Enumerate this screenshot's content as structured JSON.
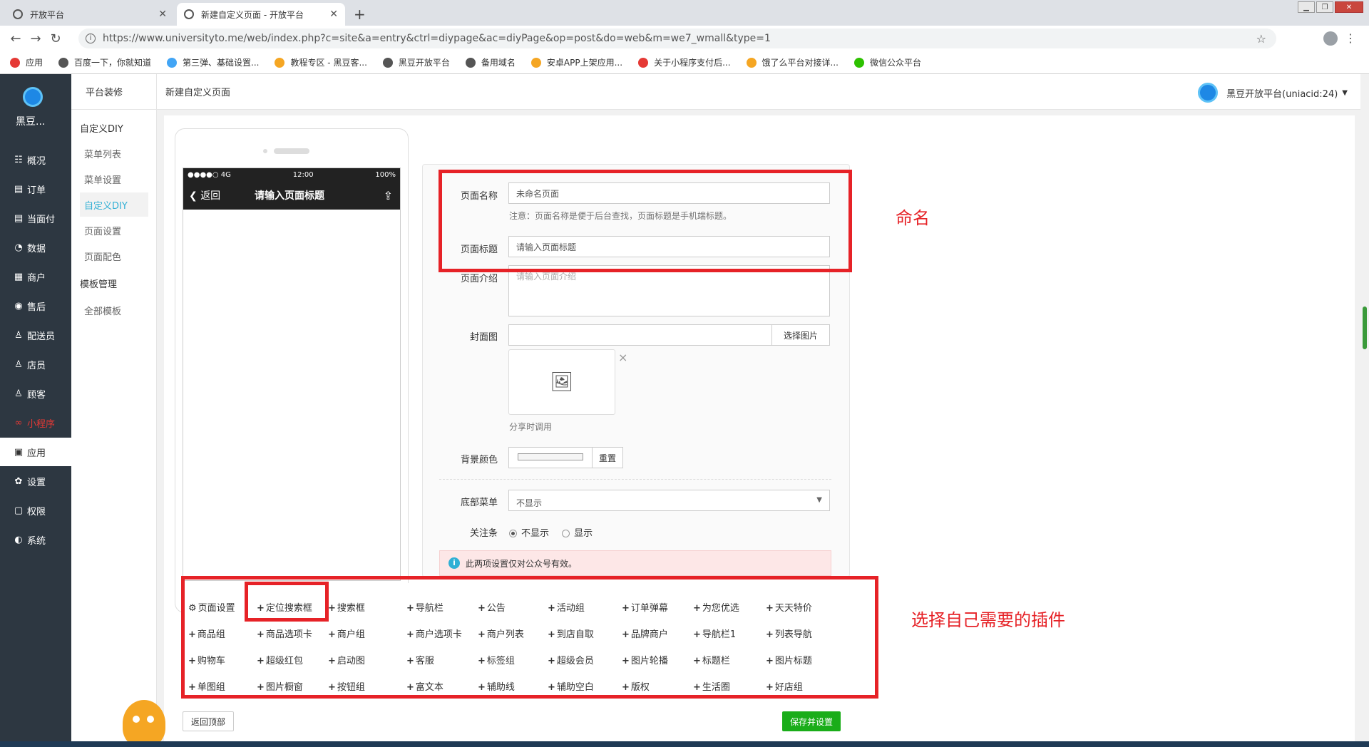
{
  "browser": {
    "tabs": [
      {
        "title": "开放平台"
      },
      {
        "title": "新建自定义页面 - 开放平台"
      }
    ],
    "new_tab": "+",
    "url": "https://www.universityto.me/web/index.php?c=site&a=entry&ctrl=diypage&ac=diyPage&op=post&do=web&m=we7_wmall&type=1",
    "bookmarks": [
      {
        "label": "应用",
        "color": "#e53935"
      },
      {
        "label": "百度一下，你就知道",
        "color": "#555555"
      },
      {
        "label": "第三弹、基础设置...",
        "color": "#42a5f5"
      },
      {
        "label": "教程专区 - 黑豆客...",
        "color": "#f5a623"
      },
      {
        "label": "黑豆开放平台",
        "color": "#555555"
      },
      {
        "label": "备用域名",
        "color": "#555555"
      },
      {
        "label": "安卓APP上架应用...",
        "color": "#f5a623"
      },
      {
        "label": "关于小程序支付后...",
        "color": "#e53935"
      },
      {
        "label": "饿了么平台对接详...",
        "color": "#f5a623"
      },
      {
        "label": "微信公众平台",
        "color": "#2dc100"
      }
    ]
  },
  "sidebar": {
    "brand": "黑豆...",
    "items": [
      {
        "label": "概况",
        "icon": "☷"
      },
      {
        "label": "订单",
        "icon": "▤"
      },
      {
        "label": "当面付",
        "icon": "▤"
      },
      {
        "label": "数据",
        "icon": "◔"
      },
      {
        "label": "商户",
        "icon": "▦"
      },
      {
        "label": "售后",
        "icon": "◉"
      },
      {
        "label": "配送员",
        "icon": "♙"
      },
      {
        "label": "店员",
        "icon": "♙"
      },
      {
        "label": "顾客",
        "icon": "♙"
      },
      {
        "label": "小程序",
        "icon": "∞"
      },
      {
        "label": "应用",
        "icon": "▣"
      },
      {
        "label": "设置",
        "icon": "✿"
      },
      {
        "label": "权限",
        "icon": "▢"
      },
      {
        "label": "系统",
        "icon": "◐"
      }
    ]
  },
  "subnav": {
    "header": "平台装修",
    "group1": "自定义DIY",
    "group1_items": [
      "菜单列表",
      "菜单设置",
      "自定义DIY",
      "页面设置",
      "页面配色"
    ],
    "group2": "模板管理",
    "group2_items": [
      "全部模板"
    ]
  },
  "topbar": {
    "title": "新建自定义页面",
    "account": "黑豆开放平台(uniacid:24)"
  },
  "phone": {
    "signal": "●●●●○ 4G",
    "time": "12:00",
    "battery": "100%",
    "back": "返回",
    "title": "请输入页面标题"
  },
  "form": {
    "page_name_label": "页面名称",
    "page_name_value": "未命名页面",
    "page_name_hint": "注意：页面名称是便于后台查找，页面标题是手机端标题。",
    "page_title_label": "页面标题",
    "page_title_placeholder": "请输入页面标题",
    "page_intro_label": "页面介绍",
    "page_intro_placeholder": "请输入页面介绍",
    "cover_label": "封面图",
    "cover_button": "选择图片",
    "cover_close": "×",
    "cover_caption": "分享时调用",
    "bg_label": "背景颜色",
    "bg_reset": "重置",
    "bottom_menu_label": "底部菜单",
    "bottom_menu_value": "不显示",
    "follow_label": "关注条",
    "follow_options": [
      "不显示",
      "显示"
    ],
    "follow_selected": "不显示",
    "notice": "此两项设置仅对公众号有效。"
  },
  "plugins": [
    [
      "页面设置",
      "定位搜索框",
      "搜索框",
      "导航栏",
      "公告",
      "活动组",
      "订单弹幕",
      "为您优选",
      "天天特价"
    ],
    [
      "商品组",
      "商品选项卡",
      "商户组",
      "商户选项卡",
      "商户列表",
      "到店自取",
      "品牌商户",
      "导航栏1",
      "列表导航"
    ],
    [
      "购物车",
      "超级红包",
      "启动图",
      "客服",
      "标签组",
      "超级会员",
      "图片轮播",
      "标题栏",
      "图片标题"
    ],
    [
      "单图组",
      "图片橱窗",
      "按钮组",
      "富文本",
      "辅助线",
      "辅助空白",
      "版权",
      "生活圈",
      "好店组"
    ]
  ],
  "footer": {
    "back_top": "返回顶部",
    "save": "保存并设置"
  },
  "annotations": {
    "naming": "命名",
    "plugins": "选择自己需要的插件"
  },
  "colors": {
    "sidebar_bg": "#2d3741",
    "accent": "#31b0d5",
    "save_green": "#1aad19",
    "annotation_red": "#e62227"
  }
}
